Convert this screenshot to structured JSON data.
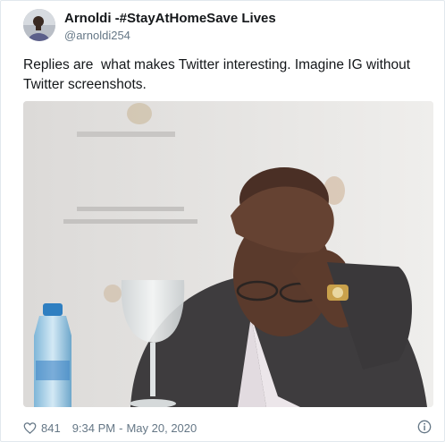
{
  "tweet": {
    "display_name": "Arnoldi -#StayAtHomeSave Lives",
    "handle": "@arnoldi254",
    "text": "Replies are  what makes Twitter interesting. Imagine IG without Twitter screenshots.",
    "likes": "841",
    "time": "9:34 PM",
    "separator": "-",
    "date": "May 20, 2020"
  },
  "icons": {
    "like": "heart-icon",
    "info": "info-icon",
    "avatar": "avatar"
  },
  "colors": {
    "name": "#14171a",
    "muted": "#657786",
    "border": "#e1e8ed"
  }
}
